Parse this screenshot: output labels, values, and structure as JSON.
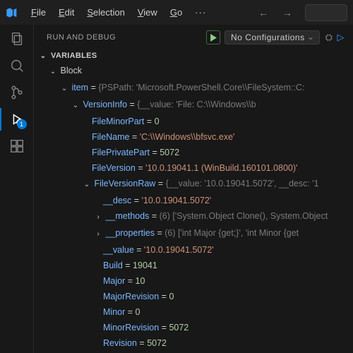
{
  "menu": {
    "items": [
      "File",
      "Edit",
      "Selection",
      "View",
      "Go"
    ],
    "overflow": "···"
  },
  "panel": {
    "title": "RUN AND DEBUG",
    "config": "No Configurations",
    "sections": {
      "variables": "VARIABLES"
    }
  },
  "activity": {
    "debug_badge": "1"
  },
  "tree": {
    "scope": "Block",
    "item": {
      "name": "item",
      "preview": "{PSPath: 'Microsoft.PowerShell.Core\\\\FileSystem::C:"
    },
    "versionInfo": {
      "name": "VersionInfo",
      "preview": "{__value: 'File:             C:\\\\Windows\\\\b"
    },
    "fileMinorPart": {
      "name": "FileMinorPart",
      "value": "0"
    },
    "fileName": {
      "name": "FileName",
      "value": "'C:\\\\Windows\\\\bfsvc.exe'"
    },
    "filePrivatePart": {
      "name": "FilePrivatePart",
      "value": "5072"
    },
    "fileVersion": {
      "name": "FileVersion",
      "value": "'10.0.19041.1 (WinBuild.160101.0800)'"
    },
    "fileVersionRaw": {
      "name": "FileVersionRaw",
      "preview": "{__value: '10.0.19041.5072', __desc: '1"
    },
    "desc": {
      "name": "__desc",
      "value": "'10.0.19041.5072'"
    },
    "methods": {
      "name": "__methods",
      "count": "(6)",
      "preview": "['System.Object Clone(), System.Object"
    },
    "properties": {
      "name": "__properties",
      "count": "(6)",
      "preview": "['int Major {get;}', 'int Minor {get"
    },
    "value": {
      "name": "__value",
      "value": "'10.0.19041.5072'"
    },
    "build": {
      "name": "Build",
      "value": "19041"
    },
    "major": {
      "name": "Major",
      "value": "10"
    },
    "majorRevision": {
      "name": "MajorRevision",
      "value": "0"
    },
    "minor": {
      "name": "Minor",
      "value": "0"
    },
    "minorRevision": {
      "name": "MinorRevision",
      "value": "5072"
    },
    "revision": {
      "name": "Revision",
      "value": "5072"
    }
  }
}
